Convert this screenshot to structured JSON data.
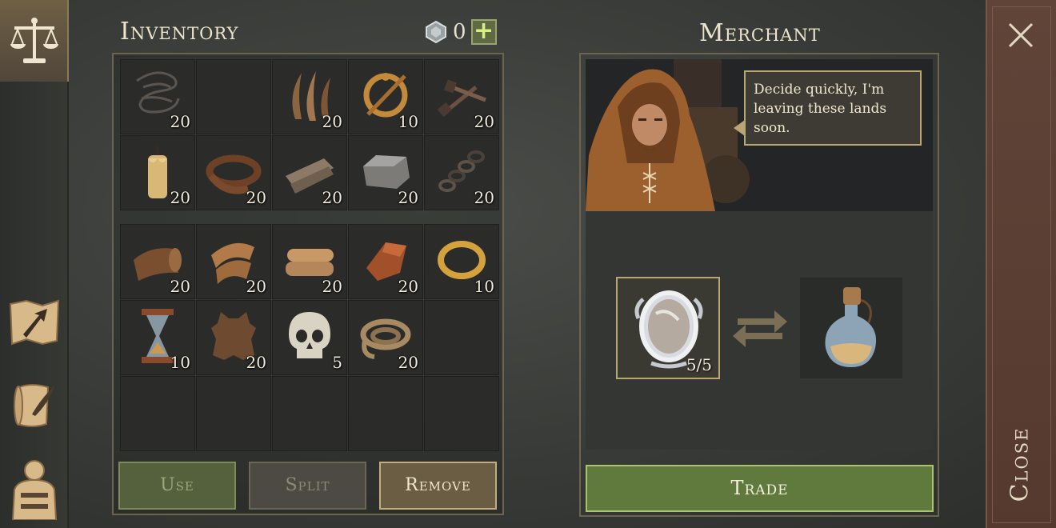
{
  "sidebar": {
    "tabs": [
      {
        "name": "trade",
        "icon": "scales-icon",
        "active": true
      },
      {
        "name": "map",
        "icon": "map-arrow-icon",
        "active": false
      },
      {
        "name": "quests",
        "icon": "scroll-quill-icon",
        "active": false
      },
      {
        "name": "character",
        "icon": "character-icon",
        "active": false
      }
    ]
  },
  "inventory": {
    "title": "Inventory",
    "currency": {
      "icon": "gem-icon",
      "count": "0",
      "add_label": "+"
    },
    "rows_a": [
      {
        "icon": "wire-icon",
        "qty": "20"
      },
      {
        "icon": "",
        "qty": ""
      },
      {
        "icon": "fibers-icon",
        "qty": "20"
      },
      {
        "icon": "brooch-icon",
        "qty": "10"
      },
      {
        "icon": "nails-icon",
        "qty": "20"
      },
      {
        "icon": "candle-icon",
        "qty": "20"
      },
      {
        "icon": "leather-strap-icon",
        "qty": "20"
      },
      {
        "icon": "planks-icon",
        "qty": "20"
      },
      {
        "icon": "stone-icon",
        "qty": "20"
      },
      {
        "icon": "chain-icon",
        "qty": "20"
      }
    ],
    "rows_b": [
      {
        "icon": "rolled-leather-icon",
        "qty": "20"
      },
      {
        "icon": "cloth-icon",
        "qty": "20"
      },
      {
        "icon": "folded-cloth-icon",
        "qty": "20"
      },
      {
        "icon": "copper-ingot-icon",
        "qty": "20"
      },
      {
        "icon": "gold-ring-icon",
        "qty": "10"
      },
      {
        "icon": "hourglass-icon",
        "qty": "10"
      },
      {
        "icon": "hide-icon",
        "qty": "20"
      },
      {
        "icon": "skull-icon",
        "qty": "5"
      },
      {
        "icon": "rope-icon",
        "qty": "20"
      },
      {
        "icon": "",
        "qty": ""
      },
      {
        "icon": "",
        "qty": ""
      },
      {
        "icon": "",
        "qty": ""
      },
      {
        "icon": "",
        "qty": ""
      },
      {
        "icon": "",
        "qty": ""
      },
      {
        "icon": "",
        "qty": ""
      }
    ],
    "buttons": {
      "use": "Use",
      "split": "Split",
      "remove": "Remove"
    }
  },
  "merchant": {
    "title": "Merchant",
    "speech": "Decide quickly, I'm leaving these lands soon.",
    "offer": {
      "icon": "mirror-icon",
      "qty": "5/5"
    },
    "receive": {
      "icon": "potion-icon"
    },
    "trade_label": "Trade"
  },
  "close": {
    "label": "Close"
  },
  "colors": {
    "background": "#3b3d3a",
    "accent_gold": "#b9a672",
    "trade_green": "#5f7a3c",
    "close_bar": "#5a3d32"
  }
}
